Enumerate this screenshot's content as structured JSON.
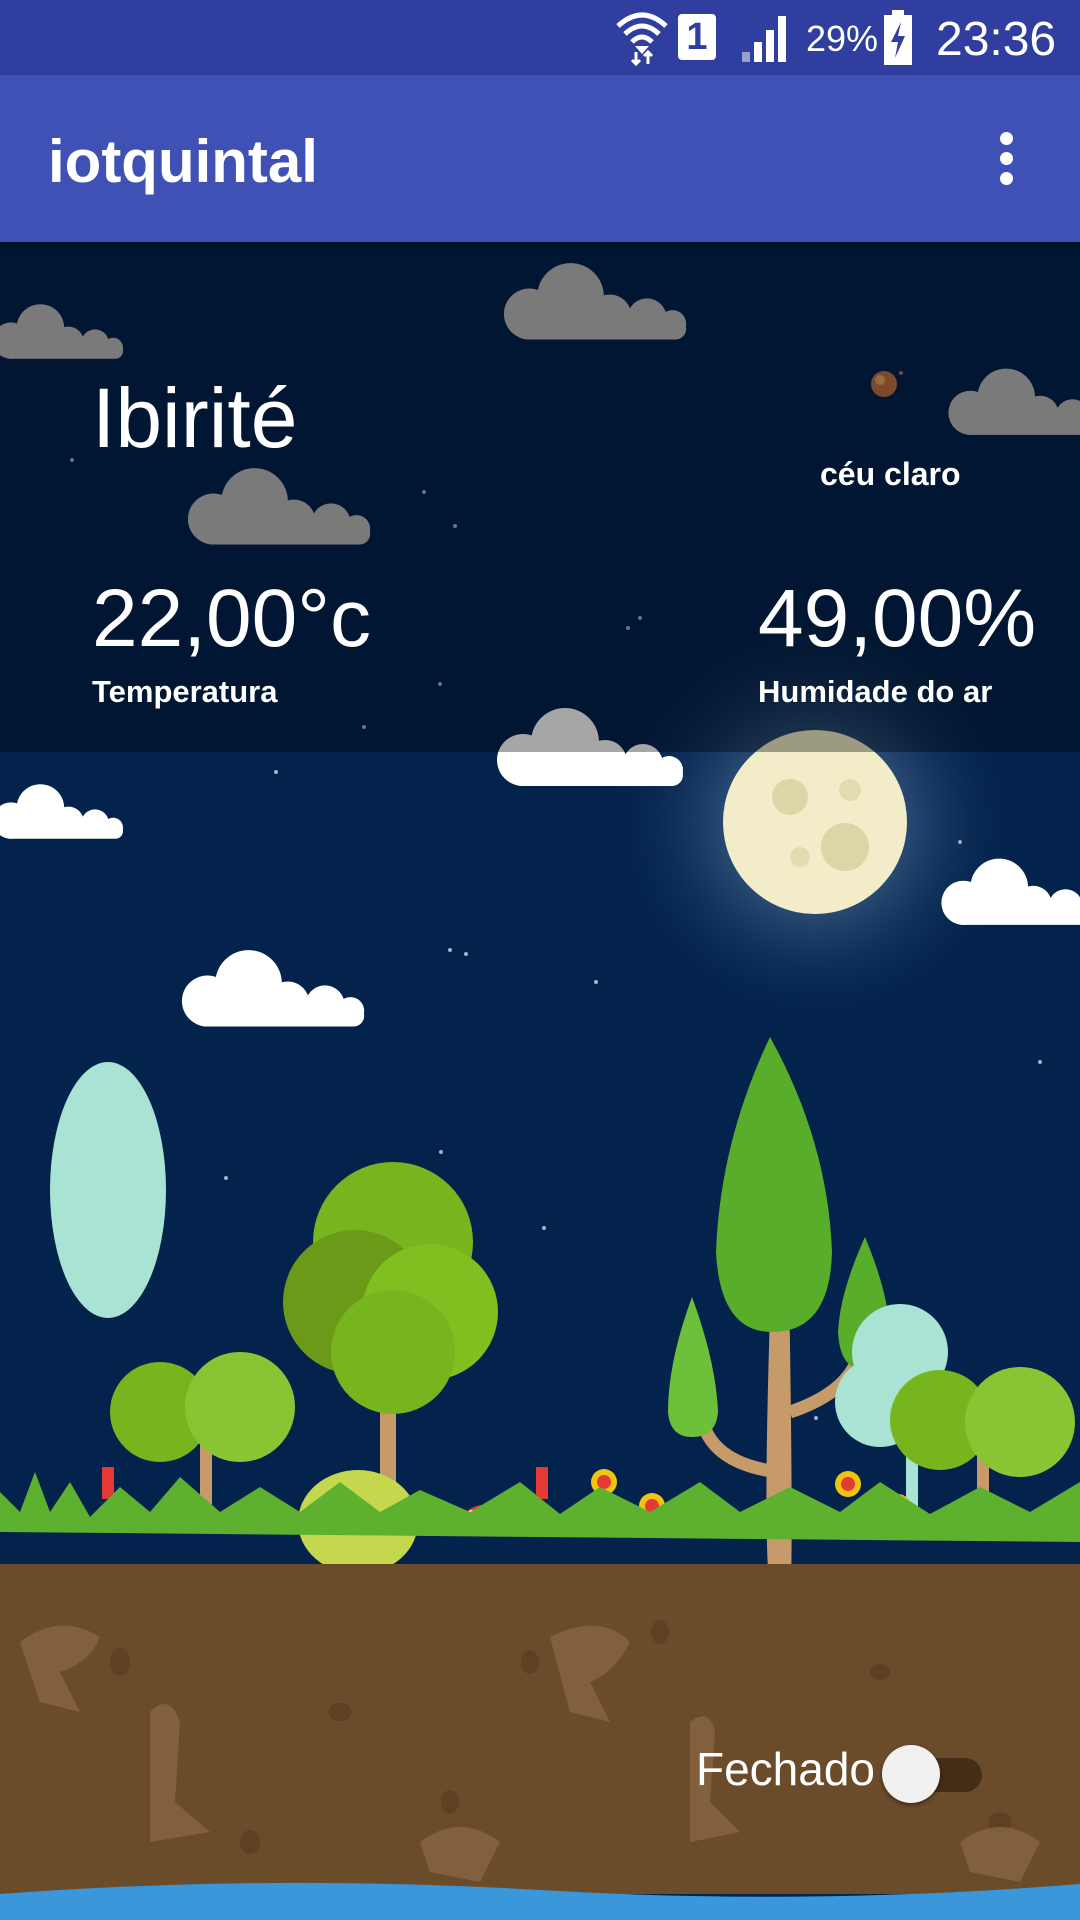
{
  "status_bar": {
    "battery": "29%",
    "sim_slot": "1",
    "time": "23:36"
  },
  "app_bar": {
    "title": "iotquintal"
  },
  "weather": {
    "city": "Ibirité",
    "description": "céu claro",
    "temperature": "22,00°c",
    "temperature_label": "Temperatura",
    "humidity": "49,00%",
    "humidity_label": "Humidade do ar"
  },
  "gate": {
    "label": "Fechado",
    "on": false
  },
  "icons": [
    "wifi-icon",
    "sim-icon",
    "signal-icon",
    "battery-charging-icon",
    "overflow-menu-icon",
    "weather-condition-icon"
  ],
  "colors": {
    "status_bar": "#303f9f",
    "app_bar": "#3f51b5",
    "sky": "#03234d",
    "soil": "#6b4c2a",
    "water": "#3a97d9"
  }
}
